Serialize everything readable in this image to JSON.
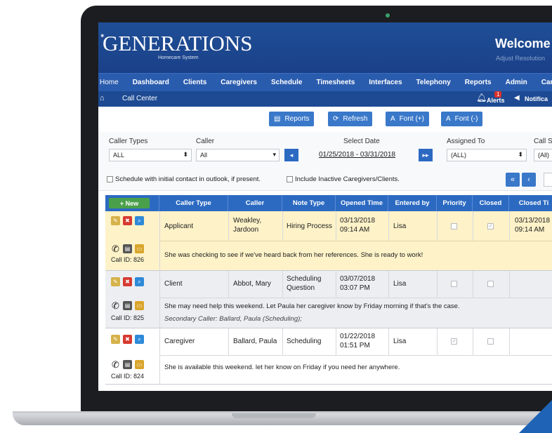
{
  "header": {
    "logo": "GENERATIONS",
    "logo_sub": "Homecare System",
    "welcome": "Welcome Ka",
    "adjust": "Adjust Resolution"
  },
  "nav": {
    "items": [
      "Home",
      "Dashboard",
      "Clients",
      "Caregivers",
      "Schedule",
      "Timesheets",
      "Interfaces",
      "Telephony",
      "Reports",
      "Admin",
      "Caregi"
    ]
  },
  "subbar": {
    "breadcrumb": "Call Center",
    "alerts_label": "Alerts",
    "alerts_count": "1",
    "notifications_label": "Notifica"
  },
  "toolbar": {
    "reports": "Reports",
    "refresh": "Refresh",
    "font_plus": "Font (+)",
    "font_minus": "Font (-)"
  },
  "filters": {
    "caller_types_label": "Caller Types",
    "caller_types_value": "ALL",
    "caller_label": "Caller",
    "caller_value": "All",
    "select_date_label": "Select Date",
    "date_range": "01/25/2018 - 03/31/2018",
    "assigned_to_label": "Assigned To",
    "assigned_to_value": "(ALL)",
    "call_status_label": "Call S",
    "call_status_value": "(All)",
    "schedule_checkbox": "Schedule with initial contact in outlook, if present.",
    "inactive_checkbox": "Include Inactive Caregivers/Clients."
  },
  "table": {
    "new_button": "+ New",
    "columns": [
      "Caller Type",
      "Caller",
      "Note Type",
      "Opened Time",
      "Entered by",
      "Priority",
      "Closed",
      "Closed Ti"
    ],
    "rows": [
      {
        "caller_type": "Applicant",
        "caller_line1": "Weakley,",
        "caller_line2": "Jardoon",
        "note_type_line1": "Hiring Process",
        "note_type_line2": "",
        "opened_line1": "03/13/2018",
        "opened_line2": "09:14 AM",
        "entered_by": "Lisa",
        "priority": false,
        "closed": true,
        "closed_line1": "03/13/2018",
        "closed_line2": "09:14 AM",
        "call_id": "Call ID: 826",
        "note": "She was checking to see if we've heard back from her references. She is ready to work!",
        "secondary": ""
      },
      {
        "caller_type": "Client",
        "caller_line1": "Abbot, Mary",
        "caller_line2": "",
        "note_type_line1": "Scheduling",
        "note_type_line2": "Question",
        "opened_line1": "03/07/2018",
        "opened_line2": "03:07 PM",
        "entered_by": "Lisa",
        "priority": false,
        "closed": false,
        "closed_line1": "",
        "closed_line2": "",
        "call_id": "Call ID: 825",
        "note": "She may need help this weekend. Let Paula her caregiver know by Friday morning if that's the case.",
        "secondary": "Secondary Caller: Ballard, Paula (Scheduling);"
      },
      {
        "caller_type": "Caregiver",
        "caller_line1": "Ballard, Paula",
        "caller_line2": "",
        "note_type_line1": "Scheduling",
        "note_type_line2": "",
        "opened_line1": "01/22/2018",
        "opened_line2": "01:51 PM",
        "entered_by": "Lisa",
        "priority": true,
        "closed": false,
        "closed_line1": "",
        "closed_line2": "",
        "call_id": "Call ID: 824",
        "note": "She is available this weekend. let her know on Friday if you need her anywhere.",
        "secondary": ""
      }
    ]
  },
  "colors": {
    "header_blue": "#1f4f97",
    "nav_blue": "#2a5cae",
    "button_blue": "#3a78c9",
    "new_green": "#4aa04a",
    "highlight_yellow": "#fdf2c8"
  }
}
